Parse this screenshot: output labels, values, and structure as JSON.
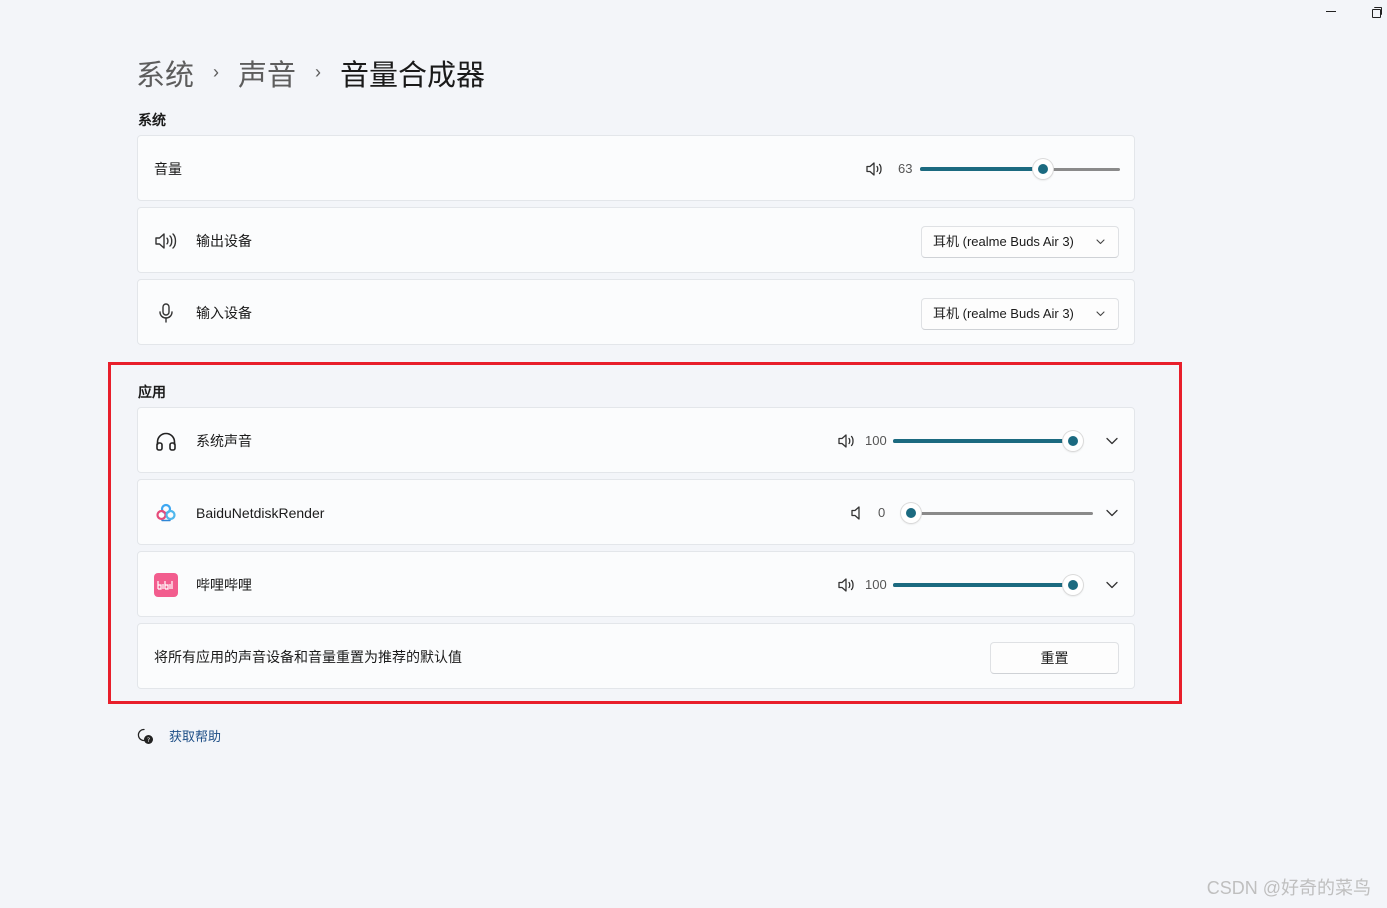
{
  "window": {
    "minimize_label": "–",
    "restore_label": "❐"
  },
  "breadcrumb": {
    "items": [
      "系统",
      "声音"
    ],
    "separator": "›",
    "current": "音量合成器"
  },
  "system_section": {
    "label": "系统",
    "volume": {
      "label": "音量",
      "value": "63",
      "level": 0.63
    },
    "output": {
      "label": "输出设备",
      "selected": "耳机 (realme Buds Air 3)"
    },
    "input": {
      "label": "输入设备",
      "selected": "耳机 (realme Buds Air 3)"
    }
  },
  "apps_section": {
    "label": "应用",
    "apps": [
      {
        "name": "系统声音",
        "value": "100",
        "level": 1.0,
        "icon": "headphones-icon"
      },
      {
        "name": "BaiduNetdiskRender",
        "value": "0",
        "level": 0.0,
        "icon": "baidu-netdisk-icon"
      },
      {
        "name": "哔哩哔哩",
        "value": "100",
        "level": 1.0,
        "icon": "bilibili-icon"
      }
    ],
    "reset": {
      "text": "将所有应用的声音设备和音量重置为推荐的默认值",
      "button": "重置"
    }
  },
  "help": {
    "label": "获取帮助"
  },
  "watermark": "CSDN @好奇的菜鸟",
  "colors": {
    "accent": "#1b6a80",
    "highlight": "#e81e2b",
    "link": "#1e4e86"
  }
}
